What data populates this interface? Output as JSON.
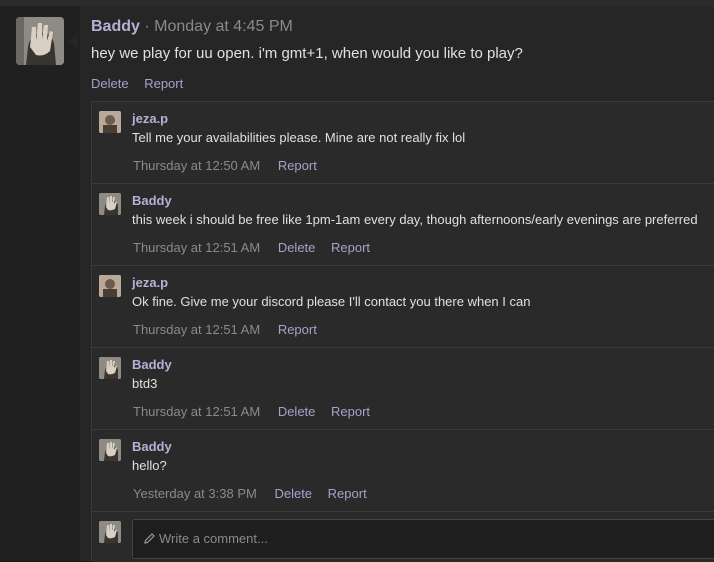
{
  "post": {
    "author": "Baddy",
    "separator": "·",
    "time": "Monday at 4:45 PM",
    "text": "hey we play for uu open. i'm gmt+1, when would you like to play?",
    "actions": {
      "delete": "Delete",
      "report": "Report"
    }
  },
  "comments": [
    {
      "author": "jeza.p",
      "text": "Tell me your availabilities please. Mine are not really fix lol",
      "time": "Thursday at 12:50 AM",
      "delete": "",
      "report": "Report"
    },
    {
      "author": "Baddy",
      "text": "this week i should be free like 1pm-1am every day, though afternoons/early evenings are preferred",
      "time": "Thursday at 12:51 AM",
      "delete": "Delete",
      "report": "Report"
    },
    {
      "author": "jeza.p",
      "text": "Ok fine. Give me your discord please I'll contact you there when I can",
      "time": "Thursday at 12:51 AM",
      "delete": "",
      "report": "Report"
    },
    {
      "author": "Baddy",
      "text": "btd3",
      "time": "Thursday at 12:51 AM",
      "delete": "Delete",
      "report": "Report"
    },
    {
      "author": "Baddy",
      "text": "hello?",
      "time": "Yesterday at 3:38 PM",
      "delete": "Delete",
      "report": "Report"
    }
  ],
  "compose": {
    "placeholder": "Write a comment..."
  },
  "icons": {
    "pencil": "pencil-icon"
  },
  "colors": {
    "accent": "#b7b0d6",
    "link": "#a5a3c9",
    "background": "#1a1a1a",
    "card": "#262626"
  }
}
